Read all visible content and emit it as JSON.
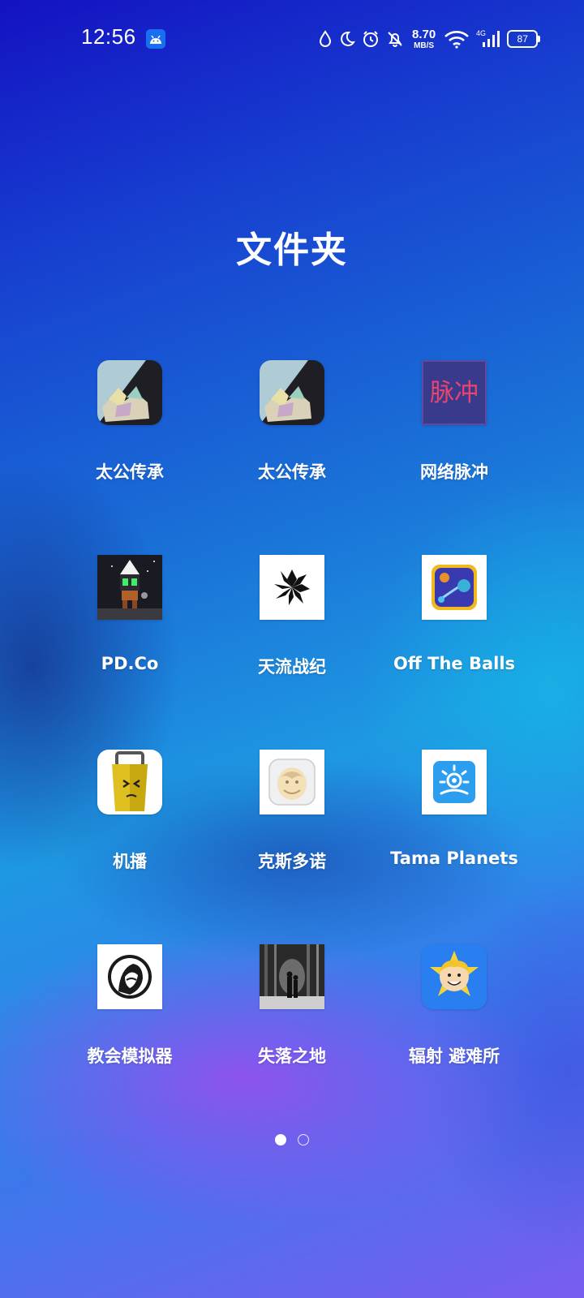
{
  "status_bar": {
    "time": "12:56",
    "notification_app_icon": "android-icon",
    "icons": [
      "water-drop-icon",
      "moon-icon",
      "alarm-icon",
      "bell-off-icon",
      "wifi-icon",
      "signal-4g-icon"
    ],
    "net_speed_value": "8.70",
    "net_speed_unit": "MB/S",
    "network_type": "4G",
    "battery_level": "87"
  },
  "folder": {
    "title": "文件夹",
    "apps": [
      {
        "label": "太公传承",
        "icon": "taigong-app-icon"
      },
      {
        "label": "太公传承",
        "icon": "taigong-app-icon"
      },
      {
        "label": "网络脉冲",
        "icon": "network-pulse-app-icon",
        "icon_text": "脉冲"
      },
      {
        "label": "PD.Co",
        "icon": "pd-co-app-icon"
      },
      {
        "label": "天流战纪",
        "icon": "tianliu-app-icon"
      },
      {
        "label": "Off The Balls",
        "icon": "off-the-balls-app-icon"
      },
      {
        "label": "机播",
        "icon": "jibo-app-icon"
      },
      {
        "label": "克斯多诺",
        "icon": "kesiduonuo-app-icon"
      },
      {
        "label": "Tama Planets",
        "icon": "tama-planets-app-icon"
      },
      {
        "label": "教会模拟器",
        "icon": "church-simulator-app-icon"
      },
      {
        "label": "失落之地",
        "icon": "lost-land-app-icon"
      },
      {
        "label": "辐射 避难所",
        "icon": "fallout-shelter-app-icon"
      }
    ]
  },
  "page_indicator": {
    "pages": 2,
    "current_page": 1
  },
  "colors": {
    "pulse_bg": "#3a3a8c",
    "pulse_text": "#e8456e",
    "android_badge": "#1a6ef0",
    "fallout_bg": "#2a7ff0",
    "tama_bg": "#2b9ef0"
  }
}
